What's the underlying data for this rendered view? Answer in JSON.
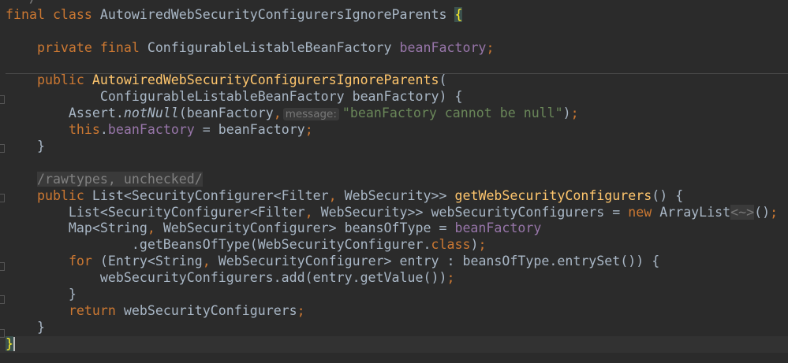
{
  "editor": {
    "theme_colors": {
      "background": "#2b2b2b",
      "text": "#a9b7c6",
      "keyword": "#cc7832",
      "method": "#ffc66d",
      "field": "#9876aa",
      "string": "#6a8759"
    },
    "lines": [
      [
        [
          "  */",
          "c"
        ]
      ],
      [
        [
          "final class ",
          "k"
        ],
        [
          "AutowiredWebSecurityConfigurersIgnoreParents ",
          ""
        ],
        [
          "{",
          "brace"
        ]
      ],
      [],
      [
        [
          "    private final ",
          "k"
        ],
        [
          "ConfigurableListableBeanFactory ",
          ""
        ],
        [
          "beanFactory",
          "f"
        ],
        [
          ";",
          "k"
        ]
      ],
      [],
      [
        [
          "    public ",
          "k"
        ],
        [
          "AutowiredWebSecurityConfigurersIgnoreParents",
          "m"
        ],
        [
          "(",
          ""
        ]
      ],
      [
        [
          "            ConfigurableListableBeanFactory beanFactory) {",
          ""
        ]
      ],
      [
        [
          "        Assert.",
          ""
        ],
        [
          "notNull",
          "i"
        ],
        [
          "(beanFactory",
          ""
        ],
        [
          ",",
          "k"
        ],
        [
          "message:",
          "hint"
        ],
        [
          "\"beanFactory cannot be null\"",
          "s"
        ],
        [
          ")",
          ""
        ],
        [
          ";",
          "k"
        ]
      ],
      [
        [
          "        ",
          ""
        ],
        [
          "this",
          "k"
        ],
        [
          ".",
          ""
        ],
        [
          "beanFactory",
          "f"
        ],
        [
          " = beanFactory",
          ""
        ],
        [
          ";",
          "k"
        ]
      ],
      [
        [
          "    }",
          ""
        ]
      ],
      [],
      [
        [
          "    ",
          ""
        ],
        [
          "/rawtypes, unchecked/",
          "sup"
        ]
      ],
      [
        [
          "    public ",
          "k"
        ],
        [
          "List<SecurityConfigurer<Filter",
          ""
        ],
        [
          ", ",
          "k"
        ],
        [
          "WebSecurity>> ",
          ""
        ],
        [
          "getWebSecurityConfigurers",
          "m"
        ],
        [
          "() {",
          ""
        ]
      ],
      [
        [
          "        List<SecurityConfigurer<Filter",
          ""
        ],
        [
          ", ",
          "k"
        ],
        [
          "WebSecurity>> webSecurityConfigurers = ",
          ""
        ],
        [
          "new ",
          "k"
        ],
        [
          "ArrayList",
          ""
        ],
        [
          "<~>",
          "fold"
        ],
        [
          "()",
          ""
        ],
        [
          ";",
          "k"
        ]
      ],
      [
        [
          "        Map<String",
          ""
        ],
        [
          ", ",
          "k"
        ],
        [
          "WebSecurityConfigurer> beansOfType = ",
          ""
        ],
        [
          "beanFactory",
          "f"
        ]
      ],
      [
        [
          "                .getBeansOfType(WebSecurityConfigurer.",
          ""
        ],
        [
          "class",
          "k"
        ],
        [
          ")",
          ""
        ],
        [
          ";",
          "k"
        ]
      ],
      [
        [
          "        ",
          ""
        ],
        [
          "for ",
          "k"
        ],
        [
          "(Entry<String",
          ""
        ],
        [
          ", ",
          "k"
        ],
        [
          "WebSecurityConfigurer> entry : beansOfType.entrySet()) {",
          ""
        ]
      ],
      [
        [
          "            webSecurityConfigurers.add(entry.getValue())",
          ""
        ],
        [
          ";",
          "k"
        ]
      ],
      [
        [
          "        }",
          ""
        ]
      ],
      [
        [
          "        ",
          ""
        ],
        [
          "return ",
          "k"
        ],
        [
          "webSecurityConfigurers",
          ""
        ],
        [
          ";",
          "k"
        ]
      ],
      [
        [
          "    }",
          ""
        ]
      ],
      [
        [
          "}",
          "brace"
        ]
      ]
    ]
  }
}
